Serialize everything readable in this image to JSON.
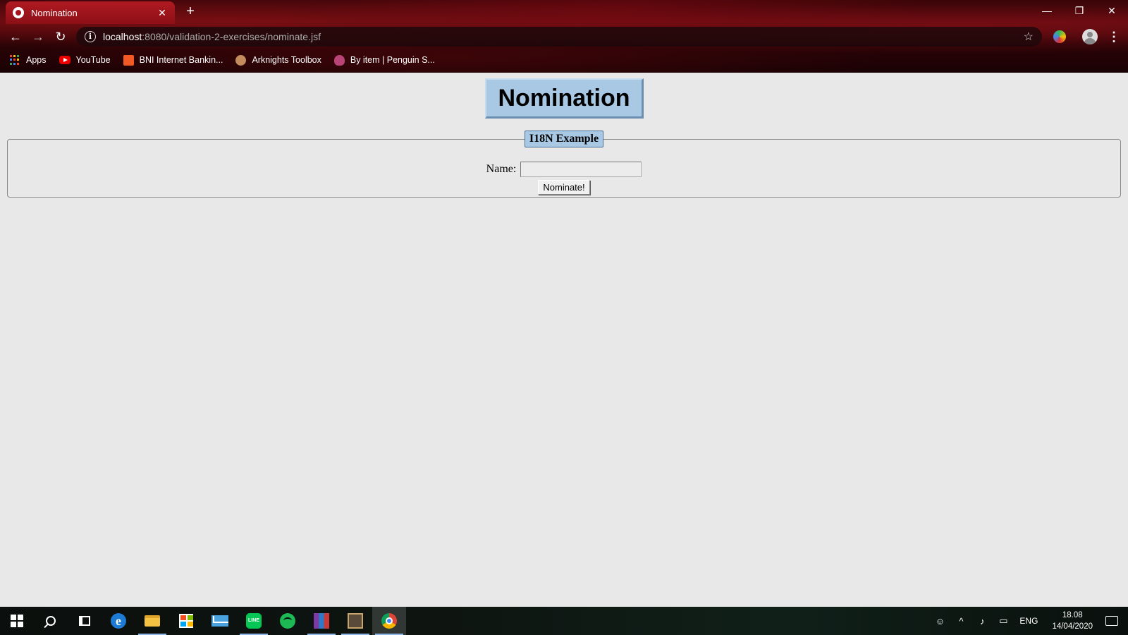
{
  "browser": {
    "tab_title": "Nomination",
    "tab_close": "✕",
    "new_tab": "+",
    "window_controls": {
      "minimize": "—",
      "restore": "❐",
      "close": "✕"
    },
    "nav": {
      "back": "←",
      "forward": "→",
      "reload": "↻"
    },
    "address": {
      "host": "localhost",
      "path": ":8080/validation-2-exercises/nominate.jsf"
    },
    "star": "☆",
    "menu": "⋮",
    "bookmarks": [
      {
        "label": "Apps",
        "icon": "apps-grid-icon"
      },
      {
        "label": "YouTube",
        "icon": "youtube-icon"
      },
      {
        "label": "BNI Internet Bankin...",
        "icon": "bni-icon"
      },
      {
        "label": "Arknights Toolbox",
        "icon": "arknights-icon"
      },
      {
        "label": "By item | Penguin S...",
        "icon": "penguin-icon"
      }
    ]
  },
  "page": {
    "heading": "Nomination",
    "fieldset_legend": "I18N Example",
    "name_label": "Name:",
    "name_value": "",
    "submit_label": "Nominate!"
  },
  "taskbar": {
    "apps": [
      "start",
      "search",
      "task-view",
      "edge",
      "file-explorer",
      "store",
      "mail",
      "line",
      "spotify",
      "winrar",
      "game",
      "chrome"
    ],
    "language": "ENG",
    "time": "18.08",
    "date": "14/04/2020"
  },
  "colors": {
    "heading_bg": "#a9c8e3",
    "tab_bg": "#a5121b",
    "page_bg": "#e8e8e8"
  }
}
